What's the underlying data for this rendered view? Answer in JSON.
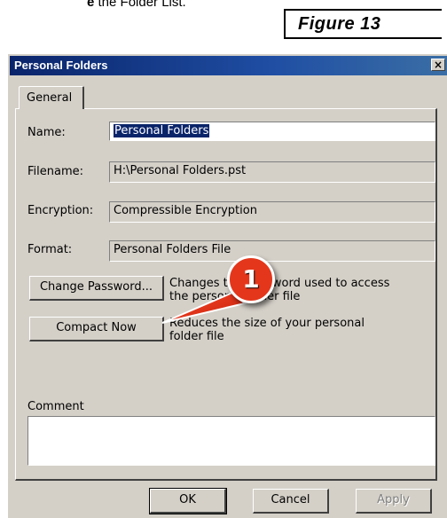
{
  "caption": {
    "fragment_bold": "e",
    "fragment_rest": " the Folder List."
  },
  "figure_label": "Figure 13",
  "dialog": {
    "title": "Personal Folders",
    "close_glyph": "×",
    "tab_general": "General",
    "name_label": "Name:",
    "name_value": "Personal Folders",
    "filename_label": "Filename:",
    "filename_value": "H:\\Personal Folders.pst",
    "encryption_label": "Encryption:",
    "encryption_value": "Compressible Encryption",
    "format_label": "Format:",
    "format_value": "Personal Folders File",
    "change_password_button": "Change Password...",
    "change_password_desc_line1": "Changes the password used to access",
    "change_password_desc_line2": "the personal folder file",
    "compact_now_button": "Compact Now",
    "compact_desc_line1": "Reduces the size of your personal",
    "compact_desc_line2": "folder file",
    "comment_label": "Comment",
    "comment_value": "",
    "ok_button": "OK",
    "cancel_button": "Cancel",
    "apply_button": "Apply"
  },
  "callout": {
    "number": "1",
    "color": "#e4361b"
  },
  "colors": {
    "dialog_face": "#d4d0c8",
    "titlebar": "#0a246a",
    "selection": "#0a246a"
  }
}
